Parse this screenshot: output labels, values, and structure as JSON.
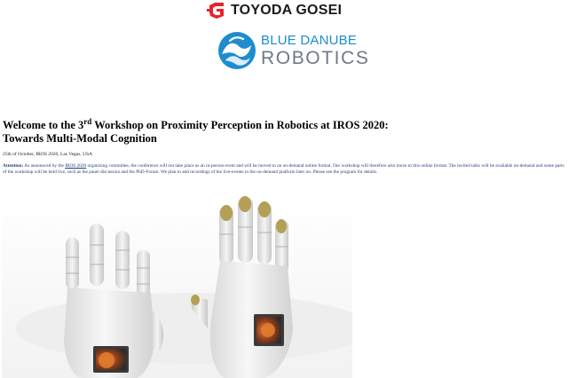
{
  "logos": {
    "toyoda_gosei": {
      "name": "TOYODA GOSEI",
      "color": "#e8232b"
    },
    "blue_danube": {
      "line1": "BLUE DANUBE",
      "line2": "ROBOTICS",
      "color_primary": "#1e8ccf",
      "color_secondary": "#6c7a86"
    }
  },
  "heading": {
    "line1_prefix": "Welcome to the 3",
    "line1_sup": "rd",
    "line1_suffix": " Workshop on Proximity Perception in Robotics at IROS 2020:",
    "line2": "Towards Multi-Modal Cognition"
  },
  "date": "25th of October, IROS 2020, Las Vegas, USA",
  "notice": {
    "label": "Attention:",
    "text_before_link": " As announced by the ",
    "link": "IROS 2020",
    "text_after_link": " organizing committee, the conference will not take place as an in-person event and will be moved to an on-demand online format. Our workshop will therefore also move to this online format. The invited talks will be available on-demand and some parts of the workshop will be held live, such as the panel discussion and the PhD-Forum. We plan to add recordings of the live-events to the on-demand platform later on. Please see the program for details."
  },
  "image": {
    "subject": "robot-hands"
  }
}
